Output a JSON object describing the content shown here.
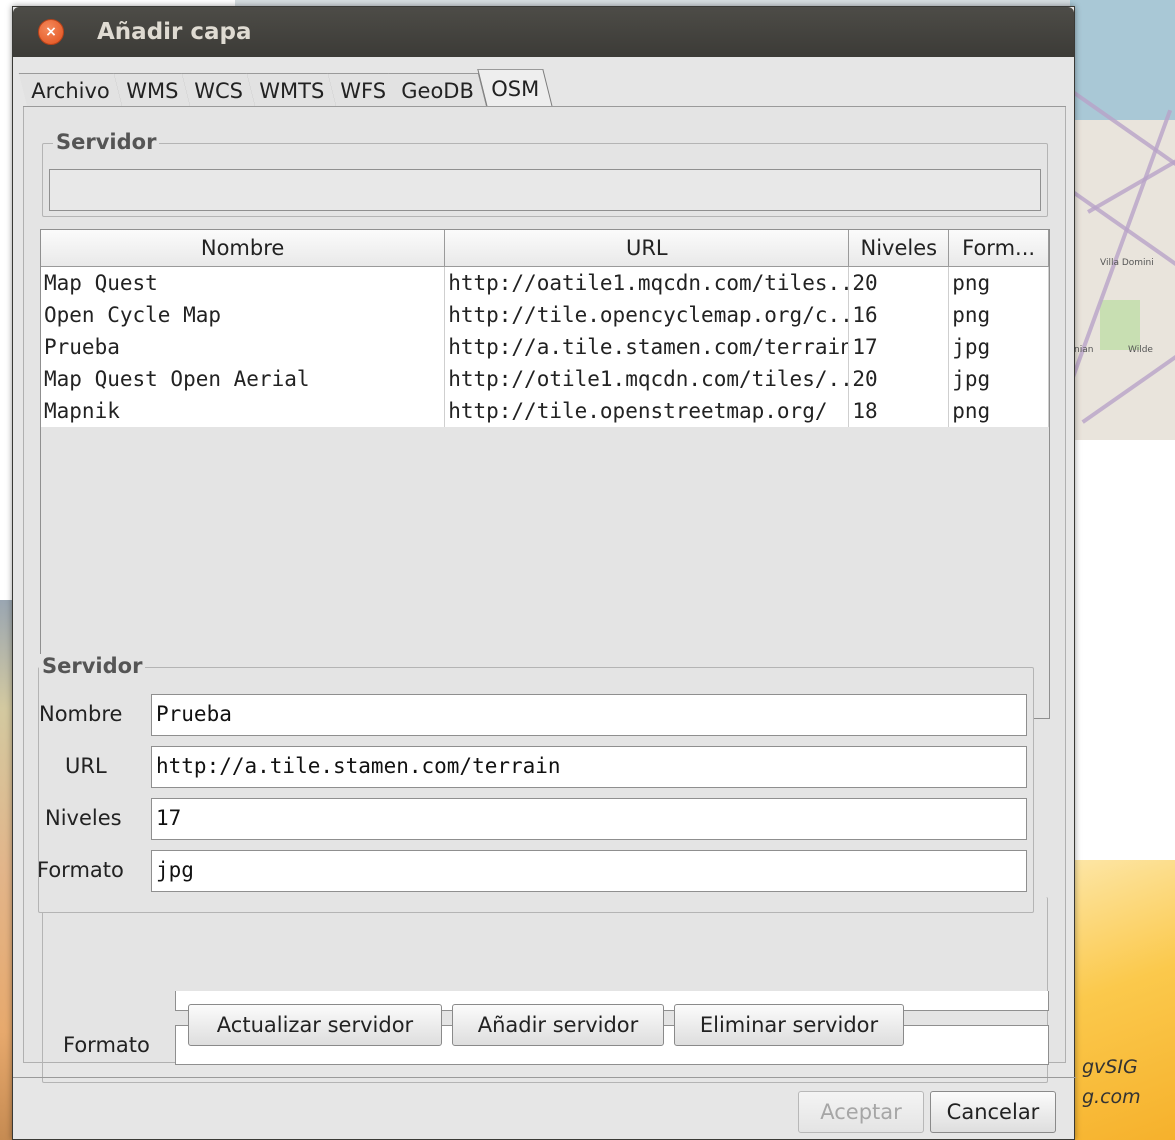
{
  "dialog": {
    "title": "Añadir capa",
    "tabs": [
      "Archivo",
      "WMS",
      "WCS",
      "WMTS",
      "WFS",
      "GeoDB",
      "OSM"
    ],
    "active_tab": "OSM"
  },
  "server_group": {
    "legend": "Servidor",
    "value": ""
  },
  "table": {
    "columns": [
      "Nombre",
      "URL",
      "Niveles",
      "Form..."
    ],
    "rows": [
      [
        "Map Quest",
        "http://oatile1.mqcdn.com/tiles...",
        "20",
        "png"
      ],
      [
        "Open Cycle Map",
        "http://tile.opencyclemap.org/c...",
        "16",
        "png"
      ],
      [
        "Prueba",
        "http://a.tile.stamen.com/terrain",
        "17",
        "jpg"
      ],
      [
        "Map Quest Open Aerial",
        "http://otile1.mqcdn.com/tiles/...",
        "20",
        "jpg"
      ],
      [
        "Mapnik",
        "http://tile.openstreetmap.org/",
        "18",
        "png"
      ]
    ]
  },
  "details": {
    "legend": "Servidor",
    "nombre_label": "Nombre",
    "nombre_value": "Prueba",
    "url_label": "URL",
    "url_value": "http://a.tile.stamen.com/terrain",
    "niveles_label": "Niveles",
    "niveles_value": "17",
    "formato_label": "Formato",
    "formato_value": "jpg",
    "formato_label_2": "Formato",
    "formato_value_2": ""
  },
  "buttons": {
    "update": "Actualizar servidor",
    "add": "Añadir servidor",
    "remove": "Eliminar servidor",
    "accept": "Aceptar",
    "cancel": "Cancelar"
  },
  "background": {
    "brand_line1": "gvSIG",
    "brand_line2": "g.com",
    "map_label_1": "Villa Domini",
    "map_label_2": "nian",
    "map_label_3": "Wilde"
  }
}
